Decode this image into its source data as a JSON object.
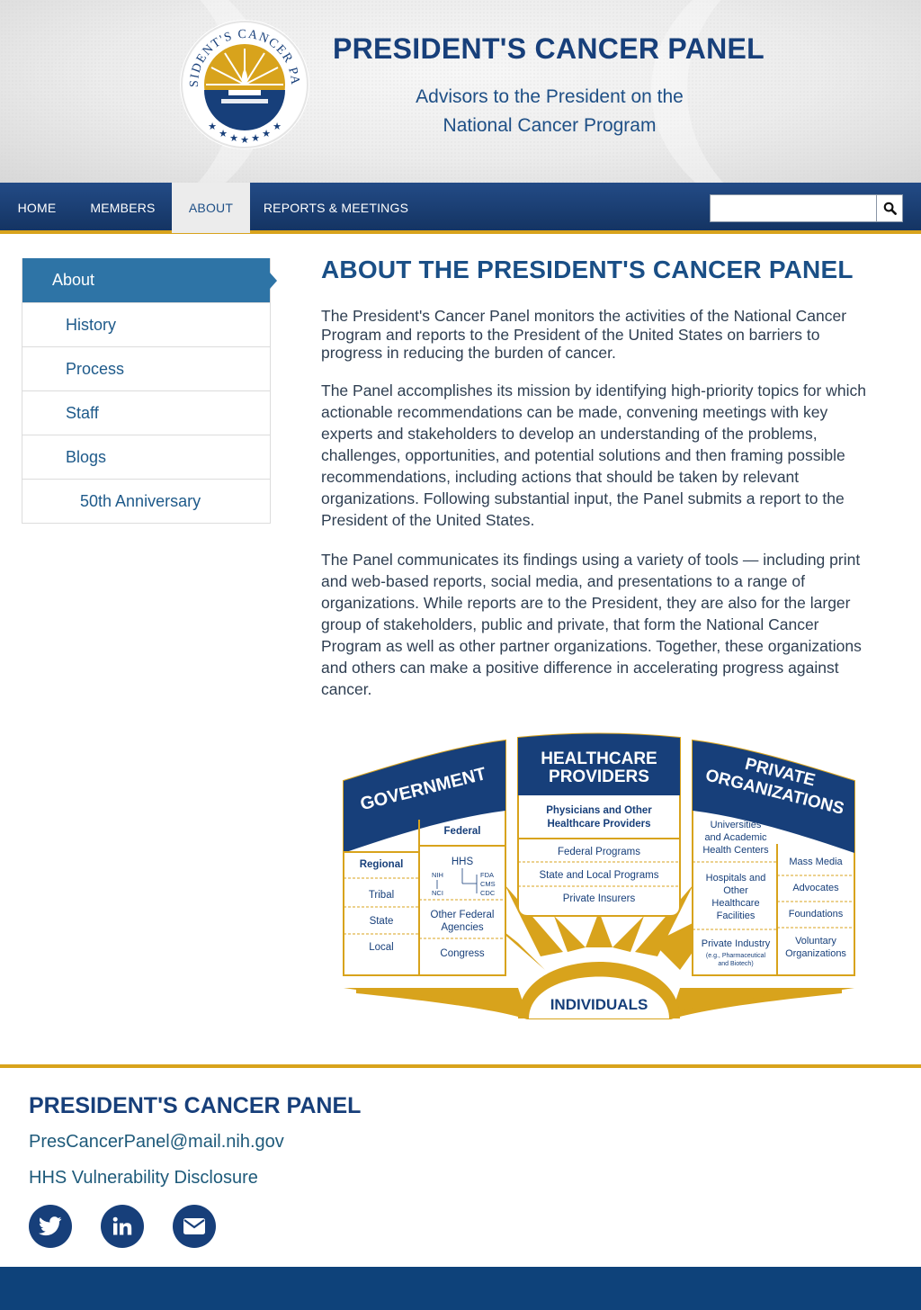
{
  "header": {
    "seal_text": "PRESIDENT'S CANCER PANEL",
    "title": "PRESIDENT'S CANCER PANEL",
    "subtitle_line1": "Advisors to the President on the",
    "subtitle_line2": "National Cancer Program"
  },
  "nav": {
    "items": [
      {
        "label": "HOME"
      },
      {
        "label": "MEMBERS"
      },
      {
        "label": "ABOUT"
      },
      {
        "label": "REPORTS & MEETINGS"
      }
    ],
    "active": "ABOUT",
    "search_value": ""
  },
  "sidebar": {
    "items": [
      {
        "label": "About"
      },
      {
        "label": "History"
      },
      {
        "label": "Process"
      },
      {
        "label": "Staff"
      },
      {
        "label": "Blogs"
      },
      {
        "label": "50th Anniversary"
      }
    ],
    "active": "About"
  },
  "main": {
    "title": "ABOUT THE PRESIDENT'S CANCER PANEL",
    "paragraphs": [
      "The President's Cancer Panel monitors the activities of the National Cancer Program and reports to the President of the United States on barriers to progress in reducing the burden of cancer.",
      "The Panel accomplishes its mission by identifying high-priority topics for which actionable recommendations can be made, convening meetings with key experts and stakeholders to develop an understanding of the problems, challenges, opportunities, and potential solutions and then framing possible recommendations, including actions that should be taken by relevant organizations. Following substantial input, the Panel submits a report to the President of the United States.",
      "The Panel communicates its findings using a variety of tools — including print and web-based reports, social media, and presentations to a range of organizations. While reports are to the President, they are also for the larger group of stakeholders, public and private, that form the National Cancer Program as well as other partner organizations. Together, these organizations and others can make a positive difference in accelerating progress against cancer."
    ]
  },
  "diagram": {
    "government": {
      "title": "GOVERNMENT",
      "left": [
        "Regional",
        "Tribal",
        "State",
        "Local"
      ],
      "right_top": "Federal",
      "hhs": "HHS",
      "hhs_left": [
        "NIH",
        "NCI"
      ],
      "hhs_right": [
        "FDA",
        "CMS",
        "CDC"
      ],
      "other_line1": "Other Federal",
      "other_line2": "Agencies",
      "congress": "Congress"
    },
    "healthcare": {
      "title_line1": "HEALTHCARE",
      "title_line2": "PROVIDERS",
      "physicians_line1": "Physicians and Other",
      "physicians_line2": "Healthcare Providers",
      "rows": [
        "Federal Programs",
        "State and Local Programs",
        "Private Insurers"
      ]
    },
    "private": {
      "title_line1": "PRIVATE",
      "title_line2": "ORGANIZATIONS",
      "univ": [
        "Universities",
        "and Academic",
        "Health Centers"
      ],
      "hosp": [
        "Hospitals and",
        "Other",
        "Healthcare",
        "Facilities"
      ],
      "industry_line1": "Private Industry",
      "industry_line2": "(e.g., Pharmaceutical",
      "industry_line3": "and Biotech)",
      "right": [
        "Mass Media",
        "Advocates",
        "Foundations"
      ],
      "voluntary_line1": "Voluntary",
      "voluntary_line2": "Organizations"
    },
    "individuals": "INDIVIDUALS"
  },
  "footer": {
    "title": "PRESIDENT'S CANCER PANEL",
    "email": "PresCancerPanel@mail.nih.gov",
    "vulnerability": "HHS Vulnerability Disclosure",
    "social": [
      "twitter-icon",
      "linkedin-icon",
      "email-icon"
    ]
  },
  "colors": {
    "navy": "#173f7a",
    "gold": "#d8a31c",
    "sidebar_active": "#2e74a6"
  }
}
